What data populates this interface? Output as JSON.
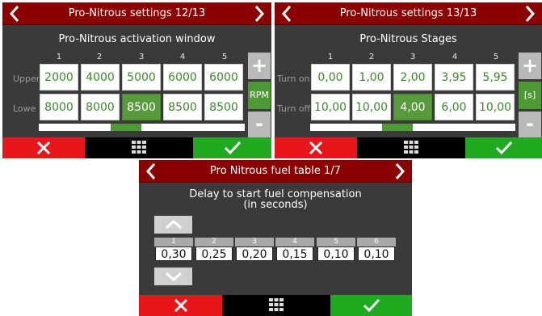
{
  "screen1": {
    "title": "Pro-Nitrous settings 12/13",
    "heading": "Pro-Nitrous activation window",
    "columns": [
      "1",
      "2",
      "3",
      "4",
      "5"
    ],
    "rows": [
      {
        "label": "Upper",
        "values": [
          "2000",
          "4000",
          "5000",
          "6000",
          "6000"
        ]
      },
      {
        "label": "Lowe",
        "values": [
          "8000",
          "8000",
          "8500",
          "8500",
          "8500"
        ]
      }
    ],
    "selected_cell": "row 2, column 3",
    "plus": "+",
    "minus": "-",
    "unit": "RPM",
    "scroll_position": 0.38
  },
  "screen2": {
    "title": "Pro-Nitrous settings 13/13",
    "heading": "Pro-Nitrous Stages",
    "columns": [
      "1",
      "2",
      "3",
      "4",
      "5"
    ],
    "rows": [
      {
        "label": "Turn on",
        "values": [
          "0,00",
          "1,00",
          "2,00",
          "3,95",
          "5,95"
        ]
      },
      {
        "label": "Turn off",
        "values": [
          "10,00",
          "10,00",
          "4,00",
          "6,00",
          "10,00"
        ]
      }
    ],
    "selected_cell": "row 2, column 3",
    "plus": "+",
    "minus": "-",
    "unit": "[s]",
    "scroll_position": 0.38
  },
  "screen3": {
    "title": "Pro Nitrous fuel table 1/7",
    "heading_line1": "Delay to start fuel compensation",
    "heading_line2": "(in seconds)",
    "cells": [
      {
        "index": "1",
        "value": "0,30"
      },
      {
        "index": "2",
        "value": "0,25"
      },
      {
        "index": "3",
        "value": "0,20"
      },
      {
        "index": "4",
        "value": "0,15"
      },
      {
        "index": "5",
        "value": "0,10"
      },
      {
        "index": "6",
        "value": "0,10"
      }
    ]
  },
  "icons": {
    "prev": "chevron-left-icon",
    "next": "chevron-right-icon",
    "cancel": "close-icon",
    "menu": "grid-menu-icon",
    "confirm": "checkmark-icon",
    "up": "chevron-up-icon",
    "down": "chevron-down-icon"
  },
  "colors": {
    "title_bar": "#8a0000",
    "background": "#3a3a3a",
    "cancel": "#e8151b",
    "confirm": "#1faa1f",
    "value_text": "#3a8a2a",
    "selected_cell": "#5a9a3e"
  }
}
